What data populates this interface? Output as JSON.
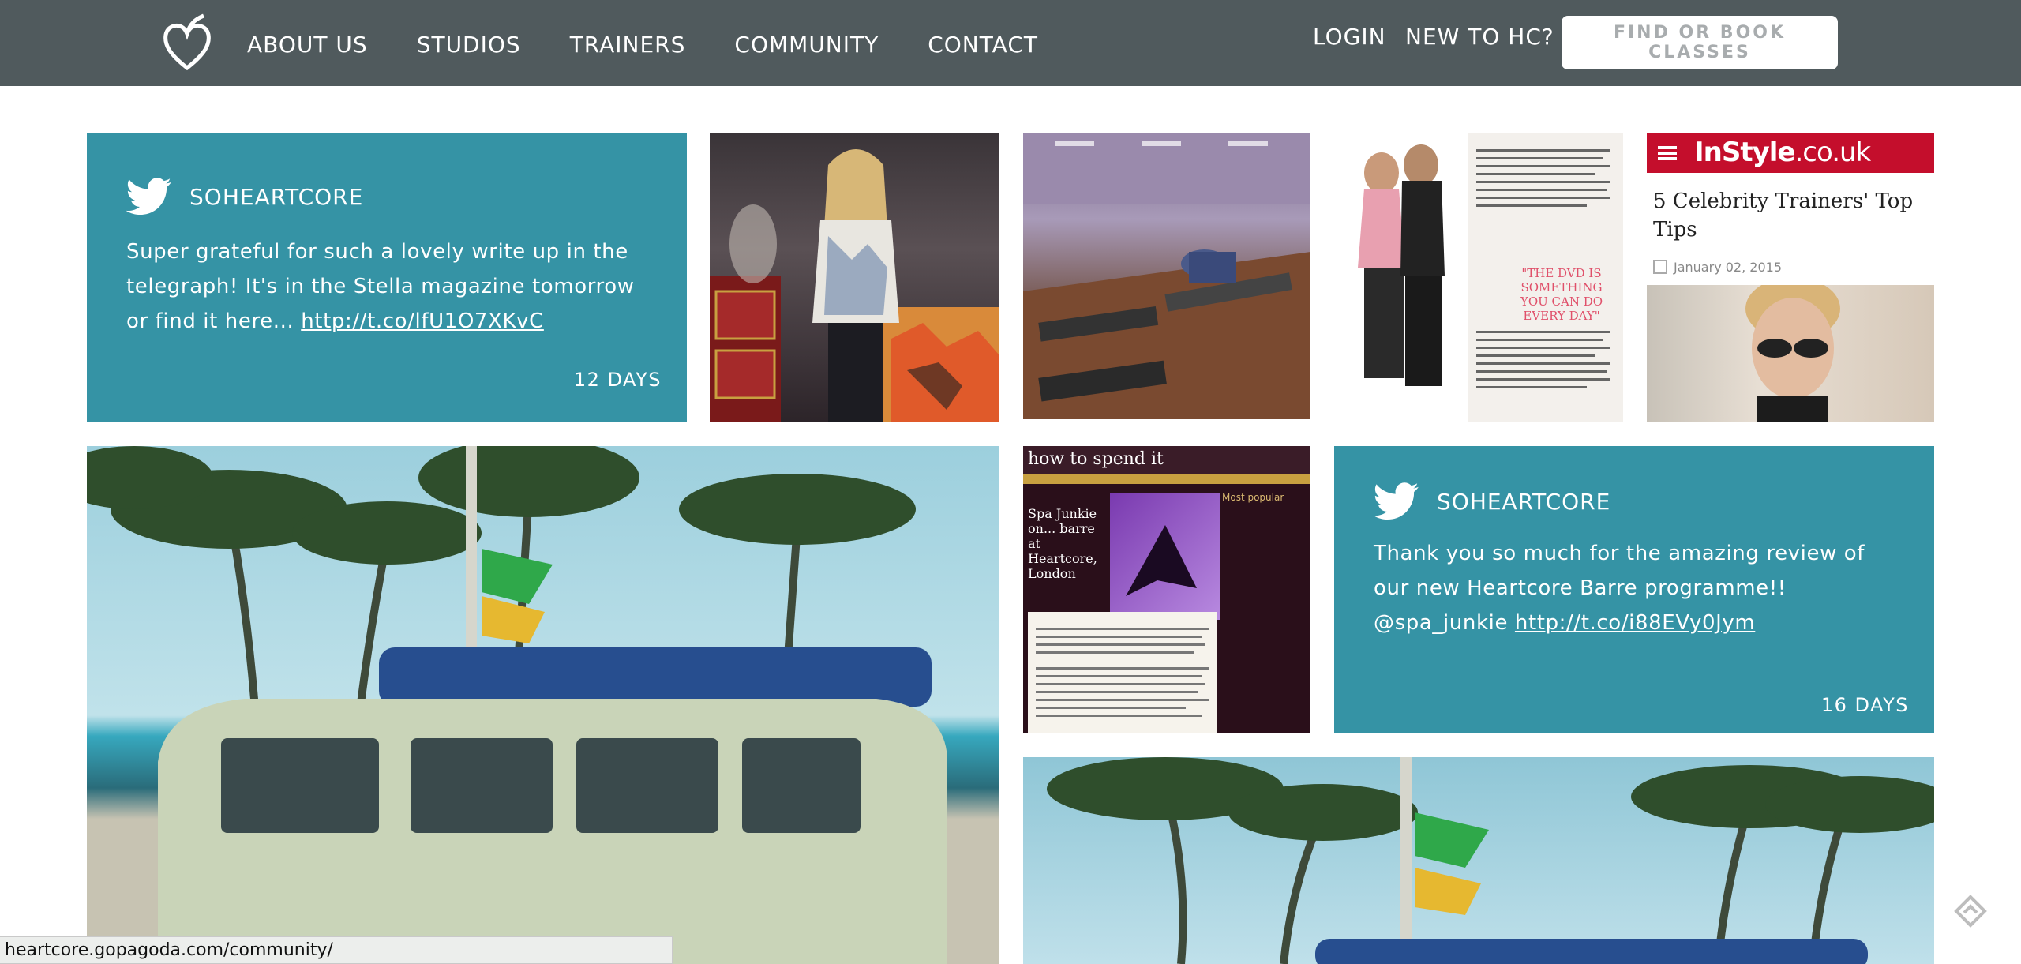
{
  "nav": {
    "links": [
      "ABOUT US",
      "STUDIOS",
      "TRAINERS",
      "COMMUNITY",
      "CONTACT"
    ],
    "login": "LOGIN",
    "new_to": "NEW TO HC?",
    "find_button": "FIND OR BOOK CLASSES"
  },
  "tweets": [
    {
      "handle": "SOHEARTCORE",
      "text": "Super grateful for such a lovely write up in the telegraph! It's in the Stella magazine tomorrow or find it here... ",
      "link": "http://t.co/lfU1O7XKvC",
      "age": "12 DAYS"
    },
    {
      "handle": "SOHEARTCORE",
      "text": "Thank you so much for the amazing review of our new Heartcore Barre programme!! @spa_junkie ",
      "link": "http://t.co/i88EVy0Jym",
      "age": "16 DAYS"
    }
  ],
  "instyle": {
    "logo_main": "InStyle",
    "logo_suffix": ".co.uk",
    "title": "5 Celebrity Trainers' Top Tips",
    "date": "January 02, 2015"
  },
  "spa": {
    "header": "how to spend it",
    "headline": "Spa Junkie on... barre at Heartcore, London",
    "sidebar_title": "Most popular"
  },
  "mag": {
    "quote": "\"THE DVD IS SOMETHING YOU CAN DO EVERY DAY\""
  },
  "status_url": "heartcore.gopagoda.com/community/",
  "colors": {
    "nav": "#505a5d",
    "teal": "#3593a5",
    "instyle_red": "#c40e2c"
  }
}
